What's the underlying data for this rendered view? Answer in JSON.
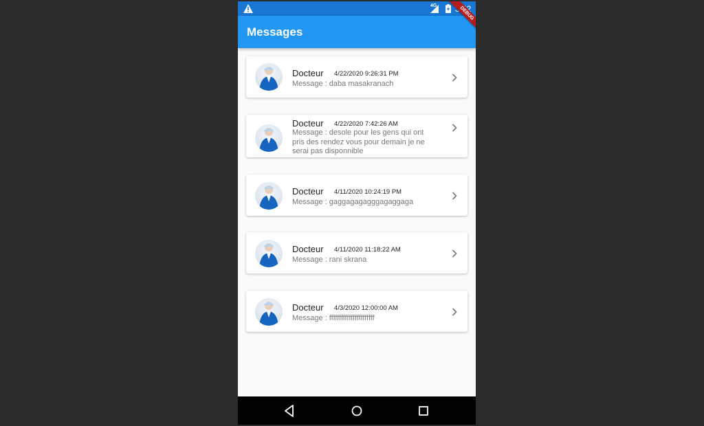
{
  "status_bar": {
    "warning_icon": "warning-icon",
    "network": "4G",
    "time": "3:42"
  },
  "debug_banner": "DEBUG",
  "app_bar": {
    "title": "Messages"
  },
  "messages": [
    {
      "name": "Docteur",
      "date": "4/22/2020 9:26:31 PM",
      "message": "Message : daba masakranach"
    },
    {
      "name": "Docteur",
      "date": "4/22/2020 7:42:26 AM",
      "message": "Message : desole pour les gens qui ont pris des rendez vous pour demain je ne serai pas disponnible"
    },
    {
      "name": "Docteur",
      "date": "4/11/2020 10:24:19 PM",
      "message": "Message : gaggagagagggagaggaga"
    },
    {
      "name": "Docteur",
      "date": "4/11/2020 11:18:22 AM",
      "message": "Message : rani skrana"
    },
    {
      "name": "Docteur",
      "date": "4/3/2020 12:00:00 AM",
      "message": "Message : fffffffffffffffffffffff"
    }
  ],
  "nav_bar": {
    "back_icon": "back-triangle-icon",
    "home_icon": "home-circle-icon",
    "recents_icon": "recents-square-icon"
  },
  "colors": {
    "app_bar": "#2196f3",
    "status_bar": "#1976d2",
    "debug_banner": "#b71c1c"
  }
}
